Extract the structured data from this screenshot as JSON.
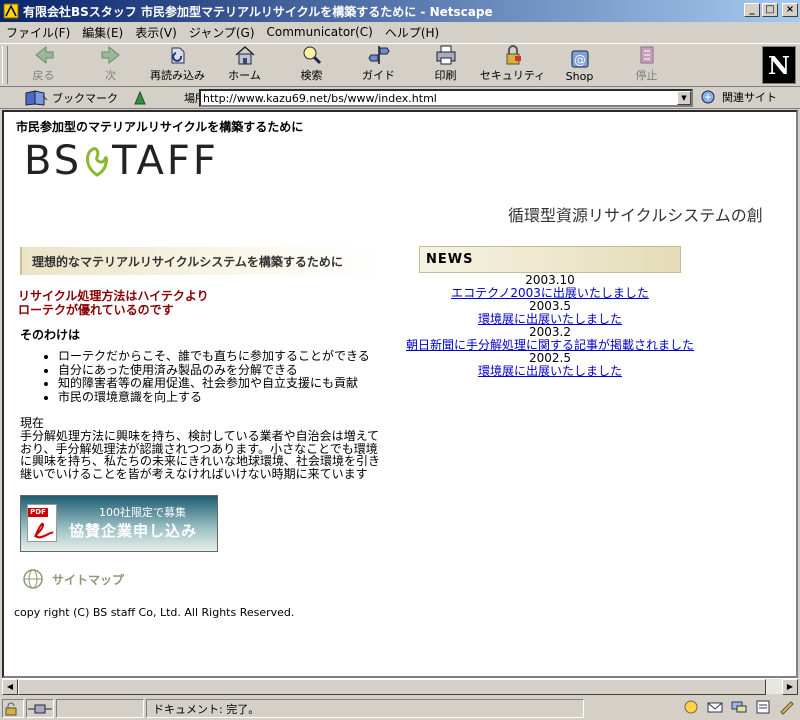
{
  "window": {
    "title": "有限会社BSスタッフ 市民参加型マテリアルリサイクルを構築するために - Netscape",
    "buttons": {
      "minimize": "_",
      "maximize": "□",
      "close": "×"
    }
  },
  "menu": [
    "ファイル(F)",
    "編集(E)",
    "表示(V)",
    "ジャンプ(G)",
    "Communicator(C)",
    "ヘルプ(H)"
  ],
  "toolbar": [
    {
      "label": "戻る",
      "icon": "back-arrow-icon",
      "enabled": false
    },
    {
      "label": "次",
      "icon": "forward-arrow-icon",
      "enabled": false
    },
    {
      "label": "再読み込み",
      "icon": "reload-icon",
      "enabled": true
    },
    {
      "label": "ホーム",
      "icon": "home-icon",
      "enabled": true
    },
    {
      "label": "検索",
      "icon": "search-icon",
      "enabled": true
    },
    {
      "label": "ガイド",
      "icon": "guide-icon",
      "enabled": true
    },
    {
      "label": "印刷",
      "icon": "print-icon",
      "enabled": true
    },
    {
      "label": "セキュリティ",
      "icon": "security-lock-icon",
      "enabled": true
    },
    {
      "label": "Shop",
      "icon": "shop-icon",
      "enabled": true
    },
    {
      "label": "停止",
      "icon": "stop-icon",
      "enabled": false
    }
  ],
  "netscape_logo": "N",
  "location": {
    "bookmarks_label": "ブックマーク",
    "location_label": "場所:",
    "url": "http://www.kazu69.net/bs/www/index.html",
    "related_label": "関連サイト"
  },
  "page": {
    "heading": "市民参加型のマテリアルリサイクルを構築するために",
    "logo_text": {
      "left": "BS",
      "right": "TAFF"
    },
    "tagline": "循環型資源リサイクルシステムの創",
    "banner": "理想的なマテリアルリサイクルシステムを構築するために",
    "red_lead": [
      "リサイクル処理方法はハイテクより",
      "ローテクが優れているのです"
    ],
    "sub_heading": "そのわけは",
    "bullets": [
      "ローテクだからこそ、誰でも直ちに参加することができる",
      "自分にあった使用済み製品のみを分解できる",
      "知的障害者等の雇用促進、社会参加や自立支援にも貢献",
      "市民の環境意識を向上する"
    ],
    "body_label": "現在",
    "body": "手分解処理方法に興味を持ち、検討している業者や自治会は増えており、手分解処理法が認識されつつあります。小さなことでも環境に興味を持ち、私たちの未来にきれいな地球環境、社会環境を引き継いでいけることを皆が考えなければいけない時期に来ています",
    "pdf_banner": {
      "pdf_tag": "PDF",
      "line1": "100社限定で募集",
      "line2": "協賛企業申し込み"
    },
    "sitemap": "サイトマップ",
    "copyright": "copy right (C) BS staff Co, Ltd. All Rights Reserved."
  },
  "news": {
    "header": "NEWS",
    "items": [
      {
        "date": "2003.10",
        "text": "エコテクノ2003に出展いたしました"
      },
      {
        "date": "2003.5",
        "text": "環境展に出展いたしました"
      },
      {
        "date": "2003.2",
        "text": "朝日新聞に手分解処理に関する記事が掲載されました"
      },
      {
        "date": "2002.5",
        "text": "環境展に出展いたしました"
      }
    ]
  },
  "status": {
    "text": "ドキュメント: 完了。"
  }
}
